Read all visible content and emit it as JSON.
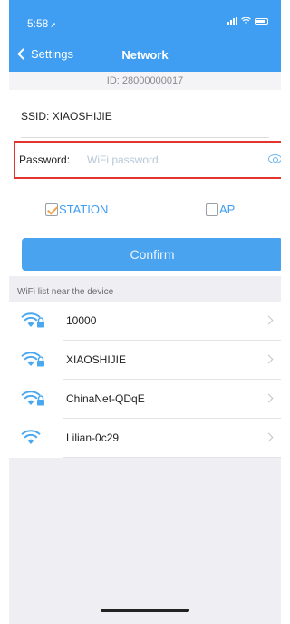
{
  "status_bar": {
    "time": "5:58",
    "location_arrow": "➚"
  },
  "nav": {
    "back_label": "Settings",
    "title": "Network"
  },
  "device": {
    "id_text": "ID: 28000000017"
  },
  "form": {
    "ssid_label": "SSID:",
    "ssid_value": "XIAOSHIJIE",
    "password_label": "Password:",
    "password_placeholder": "WiFi password",
    "password_value": "",
    "modes": [
      {
        "label": "STATION",
        "checked": true
      },
      {
        "label": "AP",
        "checked": false
      }
    ],
    "confirm_label": "Confirm"
  },
  "wifi_section": {
    "title": "WiFi list near the device",
    "networks": [
      {
        "name": "10000",
        "locked": true
      },
      {
        "name": "XIAOSHIJIE",
        "locked": true
      },
      {
        "name": "ChinaNet-QDqE",
        "locked": true
      },
      {
        "name": "Lilian-0c29",
        "locked": false
      }
    ]
  },
  "colors": {
    "accent": "#3f9ef2",
    "button": "#4aa3ef",
    "highlight_border": "#e1352d",
    "checkmark": "#f0a24a",
    "background": "#efeff3"
  },
  "icons": {
    "back": "chevron-left-icon",
    "eye": "eye-icon",
    "wifi": "wifi-icon",
    "lock": "lock-icon",
    "row_arrow": "chevron-right-icon"
  }
}
